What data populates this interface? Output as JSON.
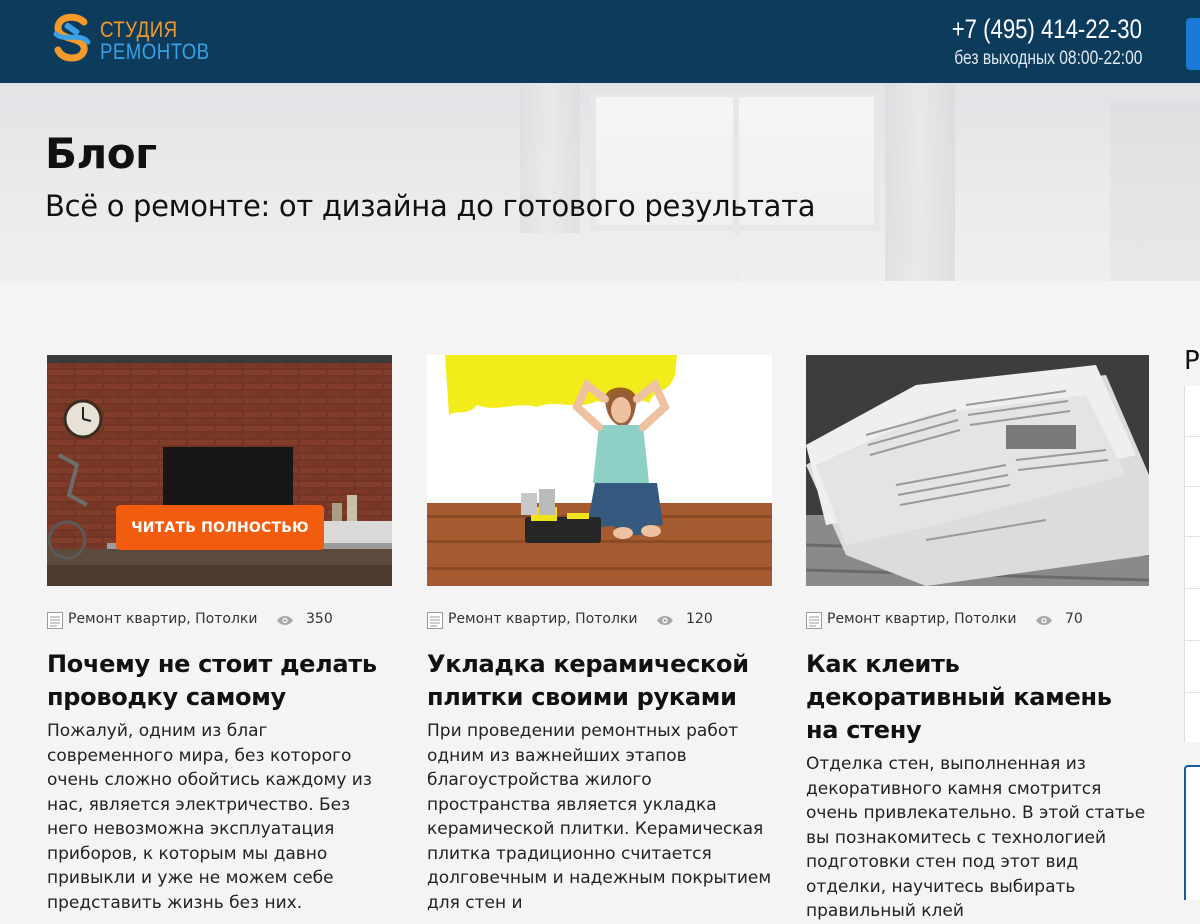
{
  "header": {
    "logo_line1": "СТУДИЯ",
    "logo_line2": "РЕМОНТОВ",
    "phone": "+7 (495) 414-22-30",
    "hours": "без выходных 08:00-22:00",
    "colors": {
      "bar": "#0c3b5c",
      "logo_orange": "#f39a2b",
      "logo_blue": "#3aa0e6"
    }
  },
  "hero": {
    "title": "Блог",
    "subtitle": "Всё  о ремонте: от дизайна до готового результата"
  },
  "cards": [
    {
      "read_more": "ЧИТАТЬ ПОЛНОСТЬЮ",
      "categories": "Ремонт квартир, Потолки",
      "views": "350",
      "title": "Почему не стоит делать проводку самому",
      "text": "Пожалуй, одним из благ современного мира, без которого очень сложно обойтись каждому из нас, является электричество. Без него невозможна эксплуатация приборов, к которым мы давно привыкли и уже не можем себе представить жизнь без них."
    },
    {
      "categories": "Ремонт квартир, Потолки",
      "views": "120",
      "title": "Укладка керамической плитки своими руками",
      "text": "При проведении ремонтных работ одним из важнейших этапов благоустройства жилого пространства является укладка керамической плитки. Керамическая плитка традиционно считается долговечным и надежным покрытием для стен и"
    },
    {
      "categories": "Ремонт квартир, Потолки",
      "views": "70",
      "title": "Как клеить декоративный камень на стену",
      "text": "Отделка стен, выполненная из декоративного камня смотрится очень привлекательно. В этой статье вы познакомитесь с технологией подготовки стен под этот вид отделки, научитесь выбирать правильный клей"
    }
  ],
  "sidebar": {
    "heading_fragment": "Р"
  },
  "colors": {
    "accent_button": "#f25c0f",
    "page_bg": "#f4f4f4"
  }
}
